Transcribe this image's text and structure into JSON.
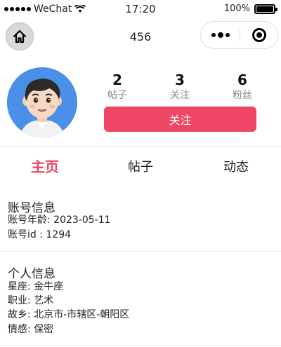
{
  "status_bar": {
    "carrier": "WeChat",
    "time": "17:20",
    "battery_percent": "100%",
    "battery_level": 1.0
  },
  "navbar": {
    "title": "456"
  },
  "profile": {
    "stats": [
      {
        "value": "2",
        "label": "帖子"
      },
      {
        "value": "3",
        "label": "关注"
      },
      {
        "value": "6",
        "label": "粉丝"
      }
    ],
    "follow_label": "关注"
  },
  "tabs": [
    {
      "label": "主页",
      "active": true
    },
    {
      "label": "帖子",
      "active": false
    },
    {
      "label": "动态",
      "active": false
    }
  ],
  "account_info": {
    "title": "账号信息",
    "lines": [
      "账号年龄: 2023-05-11",
      "账号id : 1294"
    ]
  },
  "personal_info": {
    "title": "个人信息",
    "lines": [
      "星座: 金牛座",
      "职业: 艺术",
      "故乡: 北京市-市辖区-朝阳区",
      "情感: 保密"
    ]
  },
  "colors": {
    "accent": "#ef4665",
    "avatar_bg": "#4a8fe8"
  },
  "icons": {
    "home": "home-icon",
    "more": "more-dots-icon",
    "close": "capsule-close-icon",
    "wifi": "wifi-icon",
    "battery": "battery-icon"
  }
}
